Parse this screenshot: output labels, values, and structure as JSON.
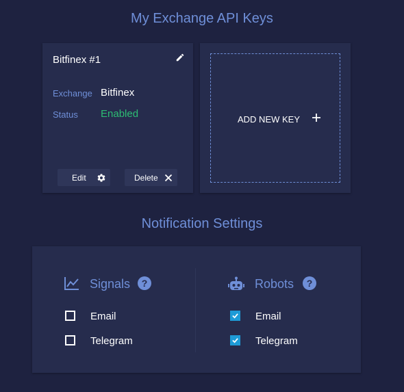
{
  "api_keys": {
    "title": "My Exchange API Keys",
    "key_card": {
      "name": "Bitfinex #1",
      "exchange_label": "Exchange",
      "exchange_value": "Bitfinex",
      "status_label": "Status",
      "status_value": "Enabled",
      "edit_label": "Edit",
      "delete_label": "Delete"
    },
    "add_new_label": "ADD NEW KEY"
  },
  "notifications": {
    "title": "Notification Settings",
    "signals": {
      "title": "Signals",
      "icon": "chart-line-icon",
      "options": [
        {
          "label": "Email",
          "checked": false
        },
        {
          "label": "Telegram",
          "checked": false
        }
      ]
    },
    "robots": {
      "title": "Robots",
      "icon": "robot-icon",
      "options": [
        {
          "label": "Email",
          "checked": true
        },
        {
          "label": "Telegram",
          "checked": true
        }
      ]
    }
  },
  "colors": {
    "background": "#1e2240",
    "card": "#262c4d",
    "accent": "#6f8fd8",
    "enabled": "#2dbd73",
    "checkbox_checked": "#1e9bd7"
  }
}
